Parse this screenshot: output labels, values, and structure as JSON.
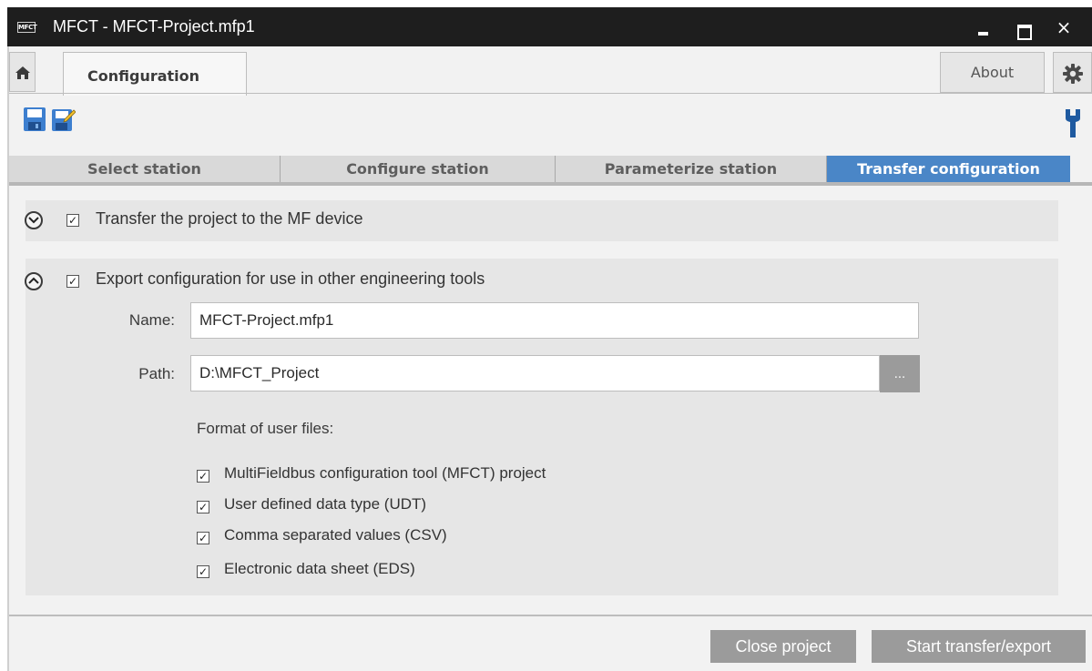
{
  "window": {
    "logo_text": "MFCT",
    "title": "MFCT - MFCT-Project.mfp1",
    "controls": {
      "minimize": "minimize-icon",
      "maximize": "maximize-icon",
      "close": "×"
    }
  },
  "tabs": {
    "home_icon": "home-icon",
    "active": "Configuration",
    "about": "About",
    "settings_icon": "gear-icon"
  },
  "toolbar": {
    "save_icon": "save-icon",
    "save_as_icon": "save-as-icon",
    "tools_icon": "wrench-icon"
  },
  "steps": [
    {
      "label": "Select station",
      "active": false
    },
    {
      "label": "Configure station",
      "active": false
    },
    {
      "label": "Parameterize station",
      "active": false
    },
    {
      "label": "Transfer configuration",
      "active": true
    }
  ],
  "sections": {
    "transfer": {
      "label": "Transfer the project to the MF device",
      "checked": true,
      "expanded": false
    },
    "export": {
      "label": "Export configuration for use in other engineering tools",
      "checked": true,
      "expanded": true,
      "name_label": "Name:",
      "name_value": "MFCT-Project.mfp1",
      "path_label": "Path:",
      "path_value": "D:\\MFCT_Project",
      "browse_label": "...",
      "format_heading": "Format of user files:",
      "formats": [
        {
          "label": "MultiFieldbus configuration tool (MFCT) project",
          "checked": true
        },
        {
          "label": "User defined data type (UDT)",
          "checked": true
        },
        {
          "label": "Comma separated values (CSV)",
          "checked": true
        },
        {
          "label": "Electronic data sheet (EDS)",
          "checked": true
        }
      ]
    }
  },
  "footer": {
    "close_project": "Close project",
    "start_transfer": "Start transfer/export"
  },
  "colors": {
    "active_step": "#4a86c7",
    "titlebar": "#1e1e1e",
    "button_gray": "#9b9b9b"
  }
}
